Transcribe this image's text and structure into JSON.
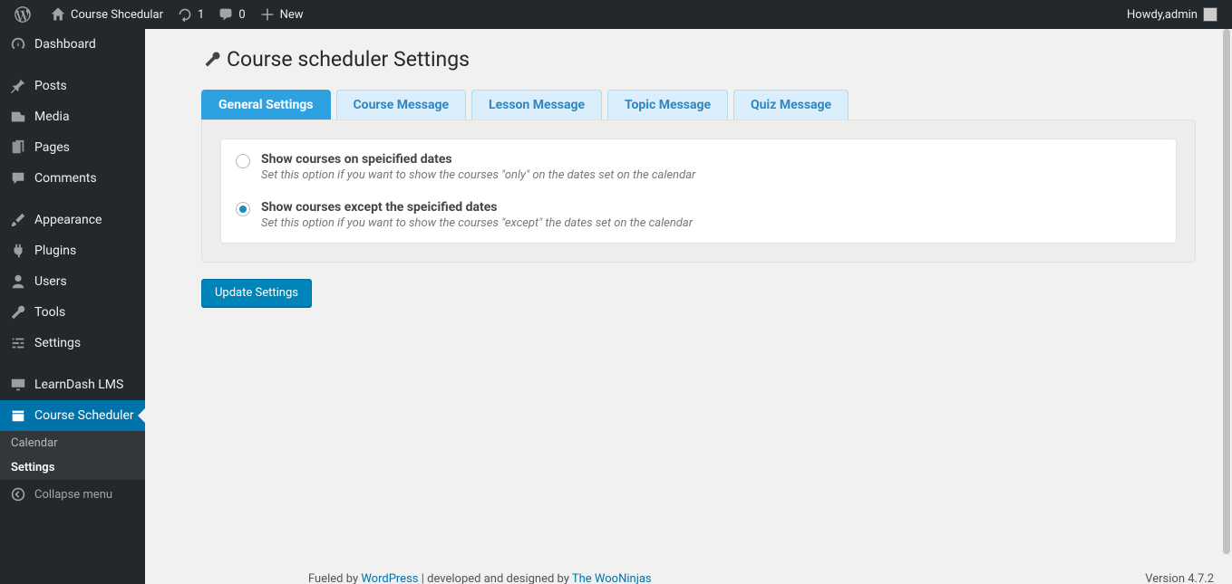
{
  "adminbar": {
    "site_title": "Course Shcedular",
    "updates_count": "1",
    "comments_count": "0",
    "new_label": "New",
    "howdy_prefix": "Howdy, ",
    "howdy_user": "admin"
  },
  "sidebar": {
    "items": [
      {
        "label": "Dashboard",
        "icon": "dashboard"
      },
      {
        "label": "Posts",
        "icon": "pin"
      },
      {
        "label": "Media",
        "icon": "media"
      },
      {
        "label": "Pages",
        "icon": "pages"
      },
      {
        "label": "Comments",
        "icon": "comment"
      },
      {
        "label": "Appearance",
        "icon": "brush"
      },
      {
        "label": "Plugins",
        "icon": "plug"
      },
      {
        "label": "Users",
        "icon": "user"
      },
      {
        "label": "Tools",
        "icon": "wrench"
      },
      {
        "label": "Settings",
        "icon": "sliders"
      },
      {
        "label": "LearnDash LMS",
        "icon": "monitor"
      },
      {
        "label": "Course Scheduler",
        "icon": "calendar",
        "current": true
      }
    ],
    "submenu": [
      {
        "label": "Calendar",
        "current": false
      },
      {
        "label": "Settings",
        "current": true
      }
    ],
    "collapse_label": "Collapse menu"
  },
  "page": {
    "title": "Course scheduler Settings",
    "tabs": [
      {
        "label": "General Settings",
        "active": true
      },
      {
        "label": "Course Message"
      },
      {
        "label": "Lesson Message"
      },
      {
        "label": "Topic Message"
      },
      {
        "label": "Quiz Message"
      }
    ],
    "options": [
      {
        "label": "Show courses on speicified dates",
        "desc": "Set this option if you want to show the courses \"only\" on the dates set on the calendar",
        "checked": false
      },
      {
        "label": "Show courses except the speicified dates",
        "desc": "Set this option if you want to show the courses \"except\" the dates set on the calendar",
        "checked": true
      }
    ],
    "submit_label": "Update Settings"
  },
  "footer": {
    "left_prefix": "Fueled by ",
    "left_link1": "WordPress",
    "left_mid": " | developed and designed by ",
    "left_link2": "The WooNinjas",
    "version": "Version 4.7.2"
  }
}
